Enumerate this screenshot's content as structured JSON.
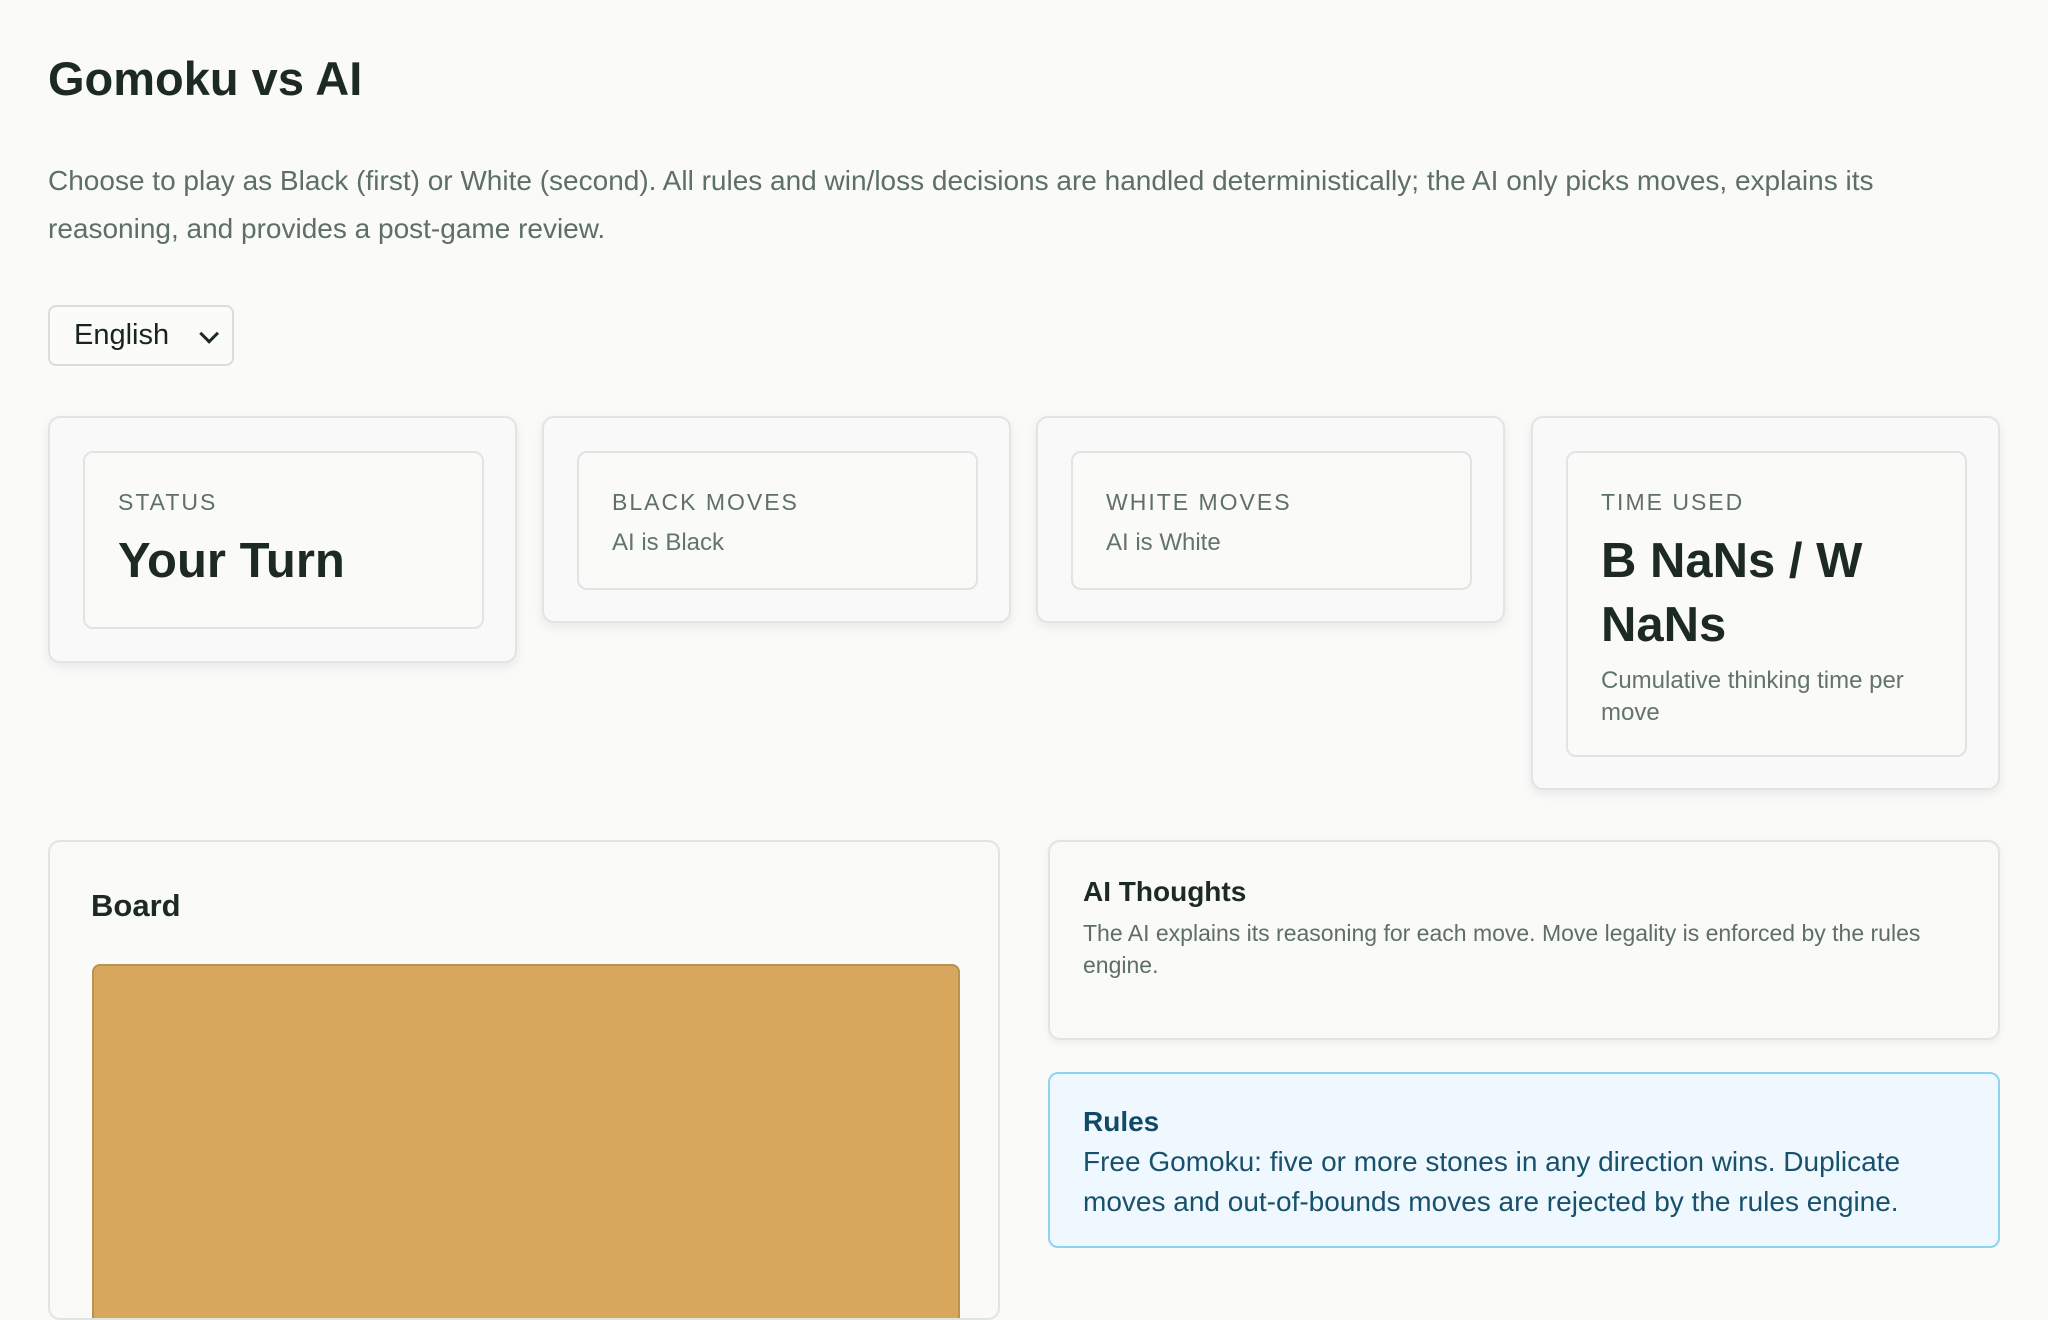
{
  "page": {
    "title": "Gomoku vs AI",
    "description": "Choose to play as Black (first) or White (second). All rules and win/loss decisions are handled deterministically; the AI only picks moves, explains its reasoning, and provides a post-game review."
  },
  "language_select": {
    "selected": "English",
    "icon": "chevron-down-icon"
  },
  "stats": {
    "status": {
      "label": "STATUS",
      "value": "Your Turn"
    },
    "black_moves": {
      "label": "BLACK MOVES",
      "subtext": "AI is Black"
    },
    "white_moves": {
      "label": "WHITE MOVES",
      "subtext": "AI is White"
    },
    "time_used": {
      "label": "TIME USED",
      "value": "B NaNs / W NaNs",
      "subtext": "Cumulative thinking time per move"
    }
  },
  "board": {
    "title": "Board"
  },
  "ai_thoughts": {
    "title": "AI Thoughts",
    "text": "The AI explains its reasoning for each move. Move legality is enforced by the rules engine."
  },
  "rules": {
    "title": "Rules",
    "text": "Free Gomoku: five or more stones in any direction wins. Duplicate moves and out-of-bounds moves are rejected by the rules engine."
  },
  "colors": {
    "page_background": "#fafaf9",
    "board_wood": "#d8a75e",
    "rules_border": "#8fd4ee",
    "rules_background": "#eff8fe",
    "heading_text": "#1c2a22",
    "muted_text": "#5d6f67"
  }
}
